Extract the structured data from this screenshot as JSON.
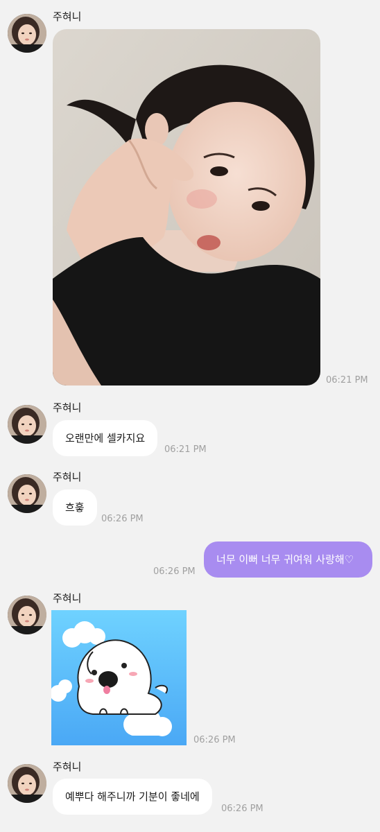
{
  "messages": [
    {
      "sender": "주혀니",
      "type": "photo",
      "time": "06:21 PM"
    },
    {
      "sender": "주혀니",
      "type": "text",
      "text": "오랜만에 셀카지요",
      "time": "06:21 PM"
    },
    {
      "sender": "주혀니",
      "type": "text",
      "text": "흐흫",
      "time": "06:26 PM"
    },
    {
      "sender": "me",
      "type": "text",
      "text": "너무 이뻐 너무 귀여워 사랑해♡",
      "time": "06:26 PM"
    },
    {
      "sender": "주혀니",
      "type": "sticker",
      "time": "06:26 PM"
    },
    {
      "sender": "주혀니",
      "type": "text",
      "text": "예뿌다 해주니까 기분이 좋네에",
      "time": "06:26 PM"
    }
  ],
  "colors": {
    "background": "#f2f2f2",
    "incoming_bubble": "#ffffff",
    "outgoing_bubble": "#a88cf0",
    "timestamp": "#a0a0a0"
  },
  "icons": {
    "avatar": "profile-photo",
    "sticker": "white-puppy-on-cloud"
  }
}
